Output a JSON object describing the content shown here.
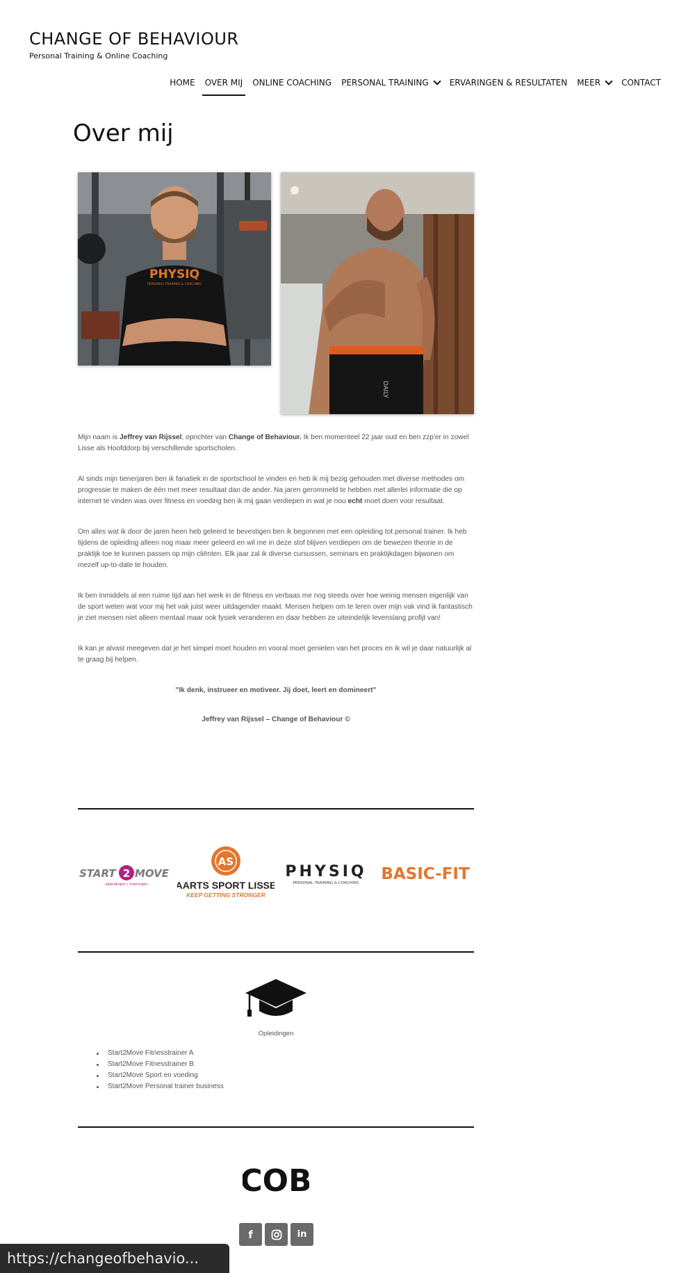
{
  "site": {
    "title": "CHANGE OF BEHAVIOUR",
    "tagline": "Personal Training & Online Coaching"
  },
  "nav": {
    "items": [
      {
        "label": "HOME"
      },
      {
        "label": "OVER MIJ"
      },
      {
        "label": "ONLINE COACHING"
      },
      {
        "label": "PERSONAL TRAINING"
      },
      {
        "label": "ERVARINGEN & RESULTATEN"
      },
      {
        "label": "MEER"
      },
      {
        "label": "CONTACT"
      }
    ]
  },
  "page": {
    "title": "Over mij"
  },
  "photos": {
    "shirt_text": "PHYSIQ",
    "shirt_sub": "PERSONAL TRAINING & COACHING",
    "shorts_text": "DAILY"
  },
  "content": {
    "p1_a": "Mijn naam is ",
    "p1_b": "Jeffrey van Rijssel",
    "p1_c": ", oprichter van ",
    "p1_d": "Change of Behaviour.",
    "p1_e": " Ik ben momenteel 22 jaar oud en ben zzp'er in zowel Lisse als Hoofddorp bij verschillende sportscholen.",
    "p2_a": "Al sinds mijn tienerjaren ben ik fanatiek in de sportschool te vinden en heb ik mij bezig gehouden met diverse methodes om progressie te maken de één met meer resultaat dan de ander. Na jaren gerommeld te hebben met allerlei informatie die op internet te vinden was over fitness en voeding ben ik mij gaan verdiepen in wat je nou ",
    "p2_b": "echt",
    "p2_c": " moet doen voor resultaat.",
    "p3": "Om alles wat ik door de jaren heen heb geleerd te bevestigen ben ik begonnen met een opleiding tot personal trainer. Ik heb tijdens de opleiding alleen nog maar meer geleerd en wil me in deze stof blijven verdiepen om de bewezen theorie in de praktijk toe te kunnen passen op mijn cliënten. Elk jaar zal ik diverse cursussen, seminars en praktijkdagen bijwonen om mezelf up-to-date te houden.",
    "p4": "Ik ben inmiddels al een ruime tijd aan het werk in de fitness en verbaas me nog steeds over hoe weinig mensen eigenlijk van de sport weten wat voor mij het vak juist weer uitdagender maakt. Mensen helpen om te leren over mijn vak vind ik fantastisch je ziet mensen niet alleen mentaal maar ook fysiek veranderen en daar hebben ze uiteindelijk levenslang profijt van!",
    "p5": "Ik kan je alvast meegeven dat je het simpel moet houden en vooral moet genieten van het proces en ik wil je daar natuurlijk al te graag bij helpen.",
    "quote": "\"Ik denk, instrueer en motiveer. Jij doet, leert en domineert\"",
    "signature": "Jeffrey van Rijssel – Change of Behaviour ©"
  },
  "logos": {
    "start2move_a": "START",
    "start2move_num": "2",
    "start2move_b": "MOVE",
    "start2move_sub": "opleidingen  •  trainingen",
    "aarts_badge": "AS",
    "aarts_name": "AARTS SPORT LISSE",
    "aarts_slogan": "KEEP GETTING STRONGER",
    "physiq_name": "PHYSIQ",
    "physiq_sub": "PERSONAL TRAINING & COACHING",
    "basicfit": "BASIC-FIT"
  },
  "education": {
    "caption": "Opleidingen",
    "items": [
      "Start2Move Fitnesstrainer A",
      "Start2Move Fitnesstrainer B",
      "Start2Move Sport en voeding",
      "Start2Move Personal trainer business"
    ]
  },
  "footer": {
    "cob_logo_text": "COB",
    "social": [
      {
        "icon": "facebook-icon",
        "glyph": "f"
      },
      {
        "icon": "instagram-icon",
        "glyph": ""
      },
      {
        "icon": "linkedin-icon",
        "glyph": "in"
      }
    ]
  },
  "status_bar": {
    "url": "https://changeofbehavio..."
  },
  "colors": {
    "text_dark": "#111111",
    "body_text": "#555555",
    "social_bg": "#6a6a6a",
    "accent_orange": "#e2762d",
    "start2move_magenta": "#b0237e"
  }
}
